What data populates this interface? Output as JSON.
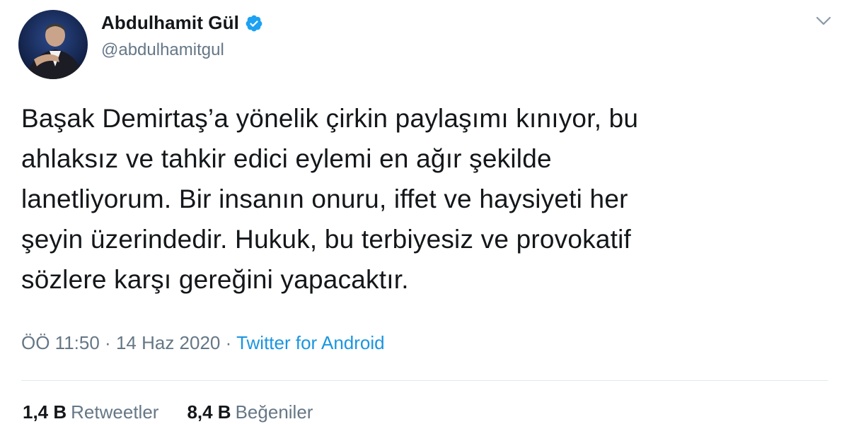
{
  "author": {
    "display_name": "Abdulhamit Gül",
    "handle": "@abdulhamitgul",
    "verified": true,
    "avatar_icon": "profile-photo",
    "verified_icon": "verified-badge-icon"
  },
  "tweet": {
    "text": "Başak Demirtaş’a yönelik  çirkin paylaşımı kınıyor, bu\nahlaksız ve tahkir edici eylemi en ağır şekilde\nlanetliyorum. Bir insanın onuru, iffet ve haysiyeti her\nşeyin üzerindedir. Hukuk, bu terbiyesiz ve provokatif\nsözlere karşı gereğini yapacaktır."
  },
  "meta": {
    "time": "ÖÖ 11:50",
    "separator": "·",
    "date": "14 Haz 2020",
    "source": "Twitter for Android"
  },
  "stats": {
    "retweets_count": "1,4 B",
    "retweets_label": "Retweetler",
    "likes_count": "8,4 B",
    "likes_label": "Beğeniler"
  },
  "colors": {
    "text": "#14171a",
    "secondary": "#657786",
    "link": "#1b95e0",
    "verified": "#1da1f2",
    "divider": "#e1e8ed"
  },
  "icons": {
    "menu": "chevron-down-icon"
  }
}
